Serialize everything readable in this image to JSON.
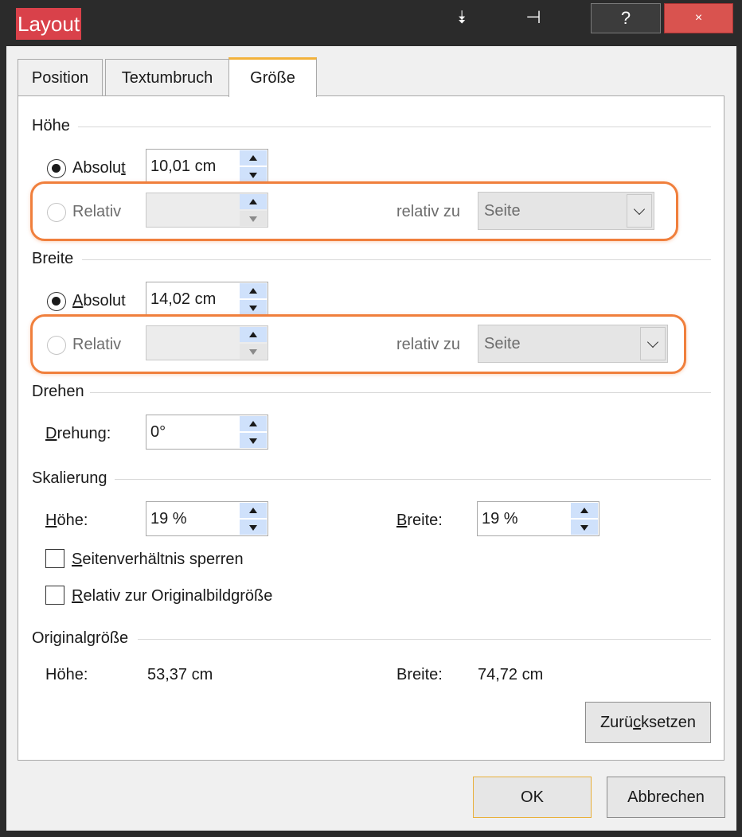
{
  "window": {
    "title": "Layout",
    "collapse_glyph": "⯯",
    "pin_glyph": "⊣",
    "help_label": "?",
    "close_label": "×"
  },
  "tabs": [
    {
      "label": "Position"
    },
    {
      "label": "Textumbruch"
    },
    {
      "label": "Größe",
      "selected": true
    }
  ],
  "hoehe": {
    "section": "Höhe",
    "absolut_label_pre": "Absolu",
    "absolut_label_u": "t",
    "absolut_value": "10,01 cm",
    "relativ_label": "Relativ",
    "relativ_value": "",
    "relativ_zu_label": "relativ zu",
    "relativ_zu_value": "Seite"
  },
  "breite": {
    "section": "Breite",
    "absolut_label_u": "A",
    "absolut_label_post": "bsolut",
    "absolut_value": "14,02 cm",
    "relativ_label": "Relativ",
    "relativ_value": "",
    "relativ_zu_label": "relativ zu",
    "relativ_zu_value": "Seite"
  },
  "drehen": {
    "section": "Drehen",
    "label_u": "D",
    "label_post": "rehung:",
    "value": "0°"
  },
  "skalierung": {
    "section": "Skalierung",
    "hoehe_label_u": "H",
    "hoehe_label_post": "öhe:",
    "hoehe_value": "19 %",
    "breite_label_u": "B",
    "breite_label_post": "reite:",
    "breite_value": "19 %",
    "lock_label_u": "S",
    "lock_label_post": "eitenverhältnis sperren",
    "relative_label_u": "R",
    "relative_label_post": "elativ zur Originalbildgröße"
  },
  "original": {
    "section": "Originalgröße",
    "hoehe_label": "Höhe:",
    "hoehe_value": "53,37 cm",
    "breite_label": "Breite:",
    "breite_value": "74,72 cm",
    "reset_pre": "Zurü",
    "reset_u": "c",
    "reset_post": "ksetzen"
  },
  "buttons": {
    "ok": "OK",
    "cancel": "Abbrechen"
  },
  "colors": {
    "title_highlight": "#d9414a",
    "annotation": "#f07f3c",
    "selected_tab_accent": "#f2b23b",
    "close_button": "#d9534f",
    "spin_button": "#cfe1fb"
  }
}
